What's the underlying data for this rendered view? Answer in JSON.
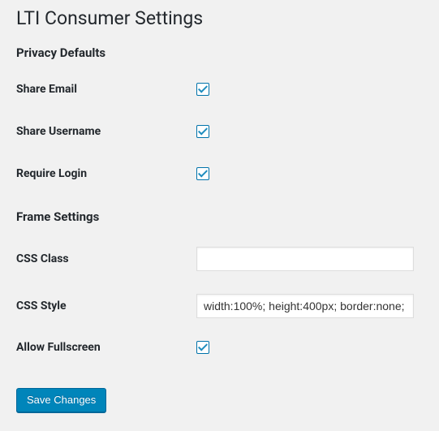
{
  "page": {
    "title": "LTI Consumer Settings"
  },
  "sections": {
    "privacy": {
      "heading": "Privacy Defaults",
      "share_email": {
        "label": "Share Email",
        "checked": true
      },
      "share_username": {
        "label": "Share Username",
        "checked": true
      },
      "require_login": {
        "label": "Require Login",
        "checked": true
      }
    },
    "frame": {
      "heading": "Frame Settings",
      "css_class": {
        "label": "CSS Class",
        "value": ""
      },
      "css_style": {
        "label": "CSS Style",
        "value": "width:100%; height:400px; border:none;"
      },
      "allow_fullscreen": {
        "label": "Allow Fullscreen",
        "checked": true
      }
    }
  },
  "actions": {
    "save_label": "Save Changes"
  }
}
